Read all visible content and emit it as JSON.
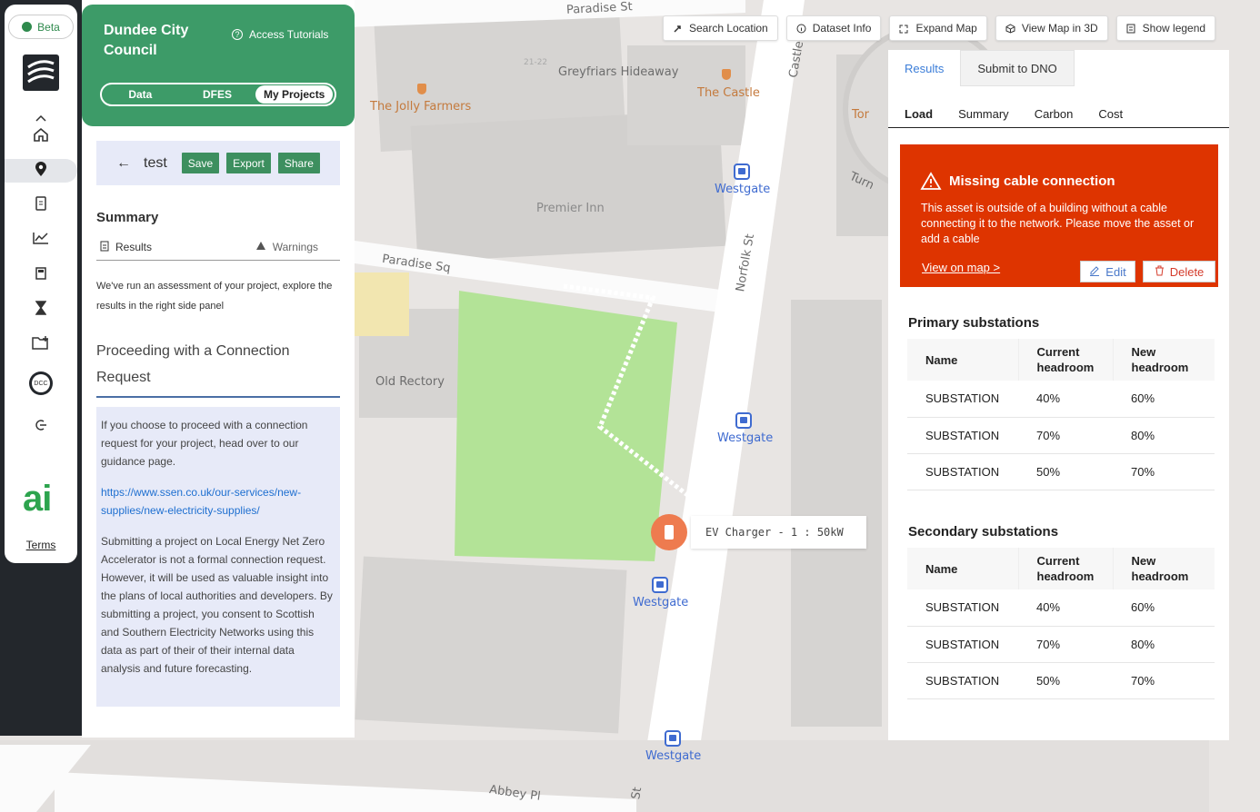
{
  "sidebar": {
    "beta_label": "Beta",
    "terms_label": "Terms",
    "ai_logo_text": "ai",
    "items": [
      {
        "name": "collapse",
        "icon": "chevron-up-icon"
      },
      {
        "name": "home",
        "icon": "home-icon"
      },
      {
        "name": "map",
        "icon": "location-pin-icon"
      },
      {
        "name": "documents",
        "icon": "document-icon"
      },
      {
        "name": "analytics",
        "icon": "chart-line-icon"
      },
      {
        "name": "catalogue",
        "icon": "book-icon"
      },
      {
        "name": "history",
        "icon": "hourglass-icon"
      },
      {
        "name": "projects",
        "icon": "folder-add-icon"
      },
      {
        "name": "account",
        "icon": "avatar-icon",
        "label": "DCC"
      },
      {
        "name": "logout",
        "icon": "logout-icon"
      }
    ]
  },
  "header": {
    "council_name": "Dundee City Council",
    "tutorials_label": "Access Tutorials",
    "modes": [
      "Data",
      "DFES",
      "My Projects"
    ],
    "active_mode": "My Projects"
  },
  "project": {
    "name": "test",
    "buttons": [
      "Save",
      "Export",
      "Share"
    ]
  },
  "summary": {
    "title": "Summary",
    "tabs": [
      "Results",
      "Warnings"
    ],
    "text": "We've run an assessment of your project, explore the results in the right side panel",
    "proceed_title": "Proceeding with a Connection Request",
    "info_para1": "If you choose to proceed with a connection request for your project, head over to our guidance page.",
    "info_link": "https://www.ssen.co.uk/our-services/new-supplies/new-electricity-supplies/",
    "info_para2": "Submitting a project on Local Energy Net Zero Accelerator is not a formal connection request. However, it will be used as valuable insight into the plans of local authorities and developers. By submitting a project, you consent to Scottish and Southern Electricity Networks using this data as part of their of their internal data analysis and future forecasting."
  },
  "map_toolbar": {
    "buttons": [
      {
        "label": "Search Location",
        "icon": "pin-icon"
      },
      {
        "label": "Dataset Info",
        "icon": "info-icon"
      },
      {
        "label": "Expand Map",
        "icon": "expand-icon"
      },
      {
        "label": "View Map in 3D",
        "icon": "cube-icon"
      },
      {
        "label": "Show legend",
        "icon": "legend-icon"
      }
    ]
  },
  "map": {
    "streets": [
      "Paradise St",
      "Paradise Sq",
      "Norfolk St",
      "Castle",
      "Turn",
      "Abbey Pl",
      "St"
    ],
    "places": [
      "Greyfriars Hideaway",
      "Premier Inn",
      "Old Rectory",
      "21-22"
    ],
    "pois": [
      "The Jolly Farmers",
      "The Castle",
      "Tor"
    ],
    "bus_stops": [
      "Westgate",
      "Westgate",
      "Westgate",
      "Westgate"
    ],
    "asset_tooltip": "EV Charger - 1 : 50kW"
  },
  "results_panel": {
    "top_tabs": [
      "Results",
      "Submit to DNO"
    ],
    "active_top_tab": "Results",
    "sub_tabs": [
      "Load",
      "Summary",
      "Carbon",
      "Cost"
    ],
    "active_sub_tab": "Load",
    "alert": {
      "title": "Missing cable connection",
      "body": "This asset is outside of a building without a cable connecting it to the network. Please move the asset or add a cable",
      "link": "View on map >",
      "edit_label": "Edit",
      "delete_label": "Delete",
      "color": "#de3400"
    },
    "primary": {
      "title": "Primary substations",
      "columns": [
        "Name",
        "Current headroom",
        "New headroom"
      ],
      "rows": [
        [
          "SUBSTATION",
          "40%",
          "60%"
        ],
        [
          "SUBSTATION",
          "70%",
          "80%"
        ],
        [
          "SUBSTATION",
          "50%",
          "70%"
        ]
      ]
    },
    "secondary": {
      "title": "Secondary substations",
      "columns": [
        "Name",
        "Current headroom",
        "New headroom"
      ],
      "rows": [
        [
          "SUBSTATION",
          "40%",
          "60%"
        ],
        [
          "SUBSTATION",
          "70%",
          "80%"
        ],
        [
          "SUBSTATION",
          "50%",
          "70%"
        ]
      ]
    }
  },
  "colors": {
    "brand_green": "#3d9b68",
    "alert_red": "#de3400",
    "link_blue": "#1e6fd0",
    "park_green": "#b3e397"
  }
}
